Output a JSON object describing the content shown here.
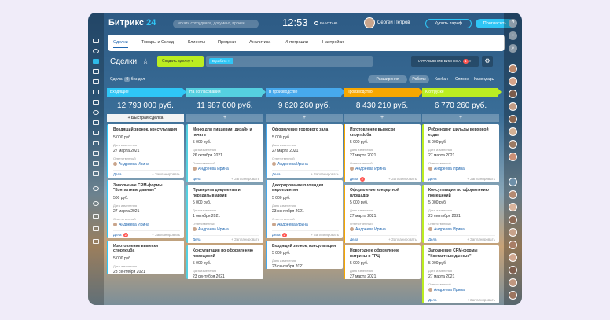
{
  "header": {
    "logo_brand": "Битрикс",
    "logo_num": "24",
    "search_placeholder": "искать сотрудника, документ, прочее...",
    "clock": "12:53",
    "work_status": "РАБОТАЮ",
    "user_name": "Сергей Петров",
    "buy_plan": "Купить тариф",
    "invite": "Пригласить"
  },
  "menu": [
    "Сделки",
    "Товары и Склад",
    "Клиенты",
    "Продажи",
    "Аналитика",
    "Интеграции",
    "Настройки"
  ],
  "toolbar": {
    "title": "Сделки",
    "create": "Создать сделку",
    "filter_chip": "В работе",
    "direction": "НАПРАВЛЕНИЕ БИЗНЕСА",
    "direction_badge": "1"
  },
  "subbar": {
    "label": "Сделки",
    "count": "0",
    "label2": "без дел",
    "extensions": "Расширения",
    "robots": "Роботы",
    "views": [
      "Канбан",
      "Список",
      "Календарь"
    ]
  },
  "labels": {
    "changed": "Дата изменения",
    "responsible": "Ответственный",
    "deals": "Дела",
    "plan": "+ Запланировать",
    "fast": "+ Быстрая сделка",
    "plus": "+"
  },
  "colors": {
    "col1": "#2fc6f6",
    "col2": "#55d0e0",
    "col3": "#47a9ec",
    "col4": "#f7a700",
    "col5": "#bbed21",
    "create": "#bbed21",
    "accent": "#2fc6f6",
    "link": "#2067b0",
    "badge": "#ff5752"
  },
  "columns": [
    {
      "name": "Входящие",
      "sum": "12 793 000 руб.",
      "cards": [
        {
          "title": "Входящий звонок, консультация",
          "price": "5 000 руб.",
          "date": "27 марта 2021",
          "resp": "Андреева Ирина",
          "badge": ""
        },
        {
          "title": "Заполнение CRM-формы \"Контактные данные\"",
          "price": "500 руб.",
          "date": "27 марта 2021",
          "resp": "Андреева Ирина",
          "badge": "2"
        },
        {
          "title": "Изготовление вывески спорткluба",
          "price": "5 000 руб.",
          "date": "23 сентября 2021",
          "resp": "",
          "badge": ""
        }
      ]
    },
    {
      "name": "На согласовании",
      "sum": "11 987 000 руб.",
      "cards": [
        {
          "title": "Меню для пиццерии: дизайн и печать",
          "price": "5 000 руб.",
          "date": "26 октября 2021",
          "resp": "Андреева Ирина",
          "badge": ""
        },
        {
          "title": "Проверить документы и передать в архив",
          "price": "5 000 руб.",
          "date": "1 октября 2021",
          "resp": "Андреева Ирина",
          "badge": ""
        },
        {
          "title": "Консультация по оформлению помещений",
          "price": "5 000 руб.",
          "date": "23 сентября 2021",
          "resp": "",
          "badge": ""
        }
      ]
    },
    {
      "name": "В производстве",
      "sum": "9 620 260 руб.",
      "cards": [
        {
          "title": "Оформление торгового зала",
          "price": "5 000 руб.",
          "date": "27 марта 2021",
          "resp": "Андреева Ирина",
          "badge": ""
        },
        {
          "title": "Декорирование площадки мероприятия",
          "price": "5 000 руб.",
          "date": "23 сентября 2021",
          "resp": "Андреева Ирина",
          "badge": "2"
        },
        {
          "title": "Входящий звонок, консультация",
          "price": "5 000 руб.",
          "date": "23 сентября 2021",
          "resp": "",
          "badge": ""
        }
      ]
    },
    {
      "name": "Производство",
      "sum": "8 430 210 руб.",
      "cards": [
        {
          "title": "Изготовление вывески спорткluба",
          "price": "5 000 руб.",
          "date": "27 марта 2021",
          "resp": "Андреева Ирина",
          "badge": "2"
        },
        {
          "title": "Оформление концертной площадки",
          "price": "5 000 руб.",
          "date": "27 марта 2021",
          "resp": "Андреева Ирина",
          "badge": ""
        },
        {
          "title": "Новогоднее оформление витрины в ТРЦ",
          "price": "5 000 руб.",
          "date": "27 марта 2021",
          "resp": "",
          "badge": ""
        }
      ]
    },
    {
      "name": "К отгрузке",
      "sum": "6 770 260 руб.",
      "cards": [
        {
          "title": "Ребрендинг шильды верховой езды",
          "price": "5 000 руб.",
          "date": "27 марта 2021",
          "resp": "Андреева Ирина",
          "badge": ""
        },
        {
          "title": "Консультация по оформлению помещений",
          "price": "5 000 руб.",
          "date": "23 сентября 2021",
          "resp": "Андреева Ирина",
          "badge": ""
        },
        {
          "title": "Заполнение CRM-формы \"Контактные данные\"",
          "price": "5 000 руб.",
          "date": "27 марта 2021",
          "resp": "Андреева Ирина",
          "badge": ""
        }
      ]
    }
  ]
}
